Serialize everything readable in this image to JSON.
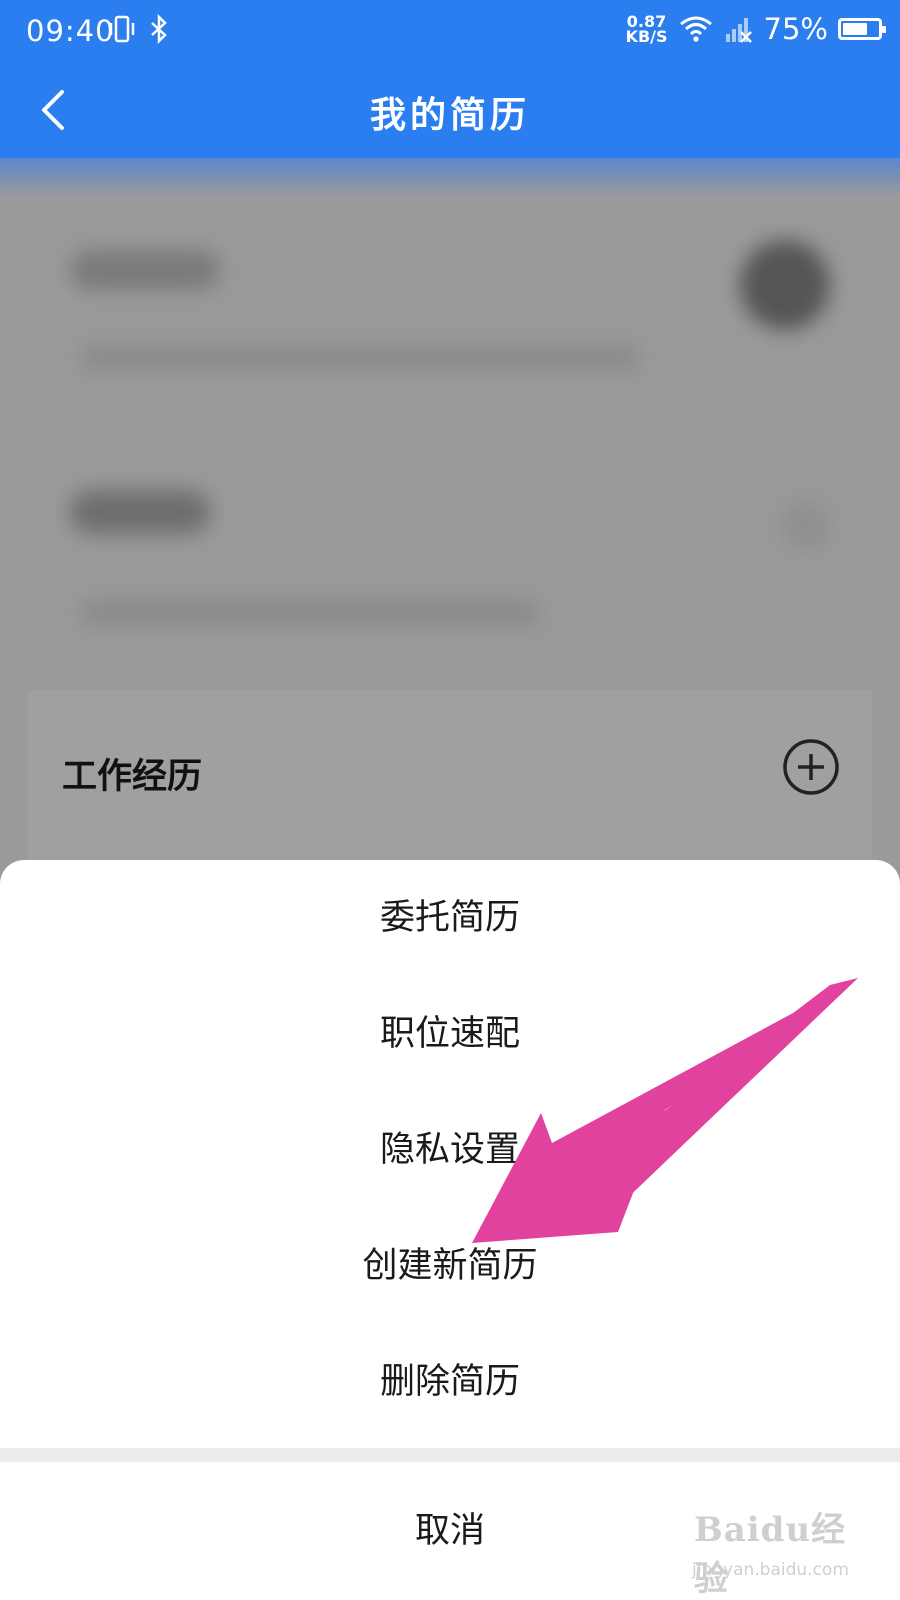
{
  "status_bar": {
    "time": "09:40",
    "speed_value": "0.87",
    "speed_unit": "KB/S",
    "battery_percent_text": "75%",
    "battery_level": 0.75,
    "icons": [
      "vibrate-icon",
      "bluetooth-icon",
      "wifi-icon",
      "signal-icon"
    ]
  },
  "navbar": {
    "title": "我的简历",
    "back_icon": "chevron-left-icon"
  },
  "background": {
    "work_experience_label": "工作经历",
    "add_icon": "plus-circle-icon"
  },
  "sheet": {
    "items": [
      {
        "label": "委托简历"
      },
      {
        "label": "职位速配"
      },
      {
        "label": "隐私设置"
      },
      {
        "label": "创建新简历"
      },
      {
        "label": "删除简历"
      }
    ],
    "cancel_label": "取消"
  },
  "annotation": {
    "arrow_color": "#e0429e"
  },
  "watermark": {
    "main": "Baidu经验",
    "sub": "jingyan.baidu.com"
  },
  "colors": {
    "primary": "#2a7ef0"
  }
}
